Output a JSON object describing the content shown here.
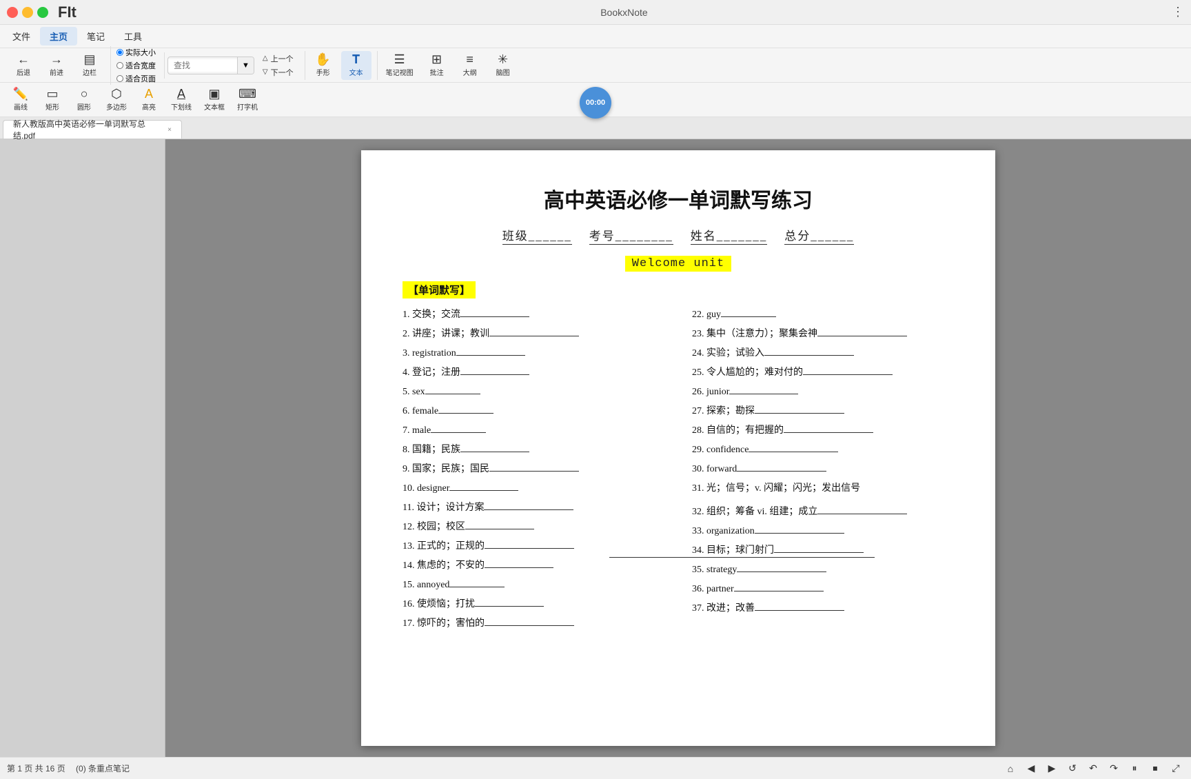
{
  "app": {
    "title": "BookxNote",
    "logo": "FIt"
  },
  "titlebar": {
    "title": "BookxNote",
    "more_icon": "⋮"
  },
  "menubar": {
    "items": [
      "文件",
      "主页",
      "笔记",
      "工具"
    ]
  },
  "toolbar1": {
    "back_label": "后退",
    "forward_label": "前进",
    "sidebar_label": "边栏",
    "fit_actual": "实际大小",
    "fit_width": "适合宽度",
    "fit_page": "适合页面",
    "search_placeholder": "查找",
    "prev_label": "上一个",
    "next_label": "下一个",
    "hand_label": "手形",
    "text_label": "文本",
    "notes_label": "笔记视图",
    "comment_label": "批注",
    "outline_label": "大纲",
    "mindmap_label": "脑图",
    "timer": "00:00"
  },
  "toolbar2": {
    "draw_label": "画线",
    "rect_label": "矩形",
    "circle_label": "圆形",
    "poly_label": "多边形",
    "highlight_label": "高亮",
    "underline_label": "下划线",
    "textbox_label": "文本框",
    "typewriter_label": "打字机"
  },
  "tab": {
    "filename": "新人教版高中英语必修一单词默写总结.pdf",
    "close": "×"
  },
  "pdf": {
    "title": "高中英语必修一单词默写练习",
    "subtitle_class": "班级",
    "subtitle_id": "考号",
    "subtitle_name": "姓名",
    "subtitle_score": "总分",
    "welcome_unit": "Welcome unit",
    "section_label": "【单词默写】",
    "vocab_items_left": [
      "1. 交换；交流",
      "2. 讲座；讲课；教训",
      "3. registration",
      "4. 登记；注册",
      "5. sex",
      "6. female",
      "7. male",
      "8. 国籍；民族",
      "9. 国家；民族；国民",
      "10. designer",
      "11. 设计；设计方案",
      "12. 校园；校区",
      "13. 正式的；正规的",
      "14. 焦虑的；不安的",
      "15. annoyed",
      "16. 使烦恼；打扰",
      "17. 惊吓的；害怕的"
    ],
    "vocab_items_right": [
      "22. guy",
      "23. 集中（注意力）；聚集会神",
      "24. 实验；试验入",
      "25. 令人尴尬的；难对付的",
      "26. junior",
      "27. 探索；勘探",
      "28. 自信的；有把握的",
      "29. confidence",
      "30. forward",
      "31. 光；信号；v. 闪耀；闪光；发出信号",
      "32. 组织；筹备 vi. 组建；成立",
      "33. organization",
      "34. 目标；球门射门",
      "35. strategy",
      "36. partner",
      "37. 改进；改善"
    ]
  },
  "statusbar": {
    "page_info": "第 1 页 共 16 页",
    "notes_count": "(0) 条重点笔记"
  }
}
